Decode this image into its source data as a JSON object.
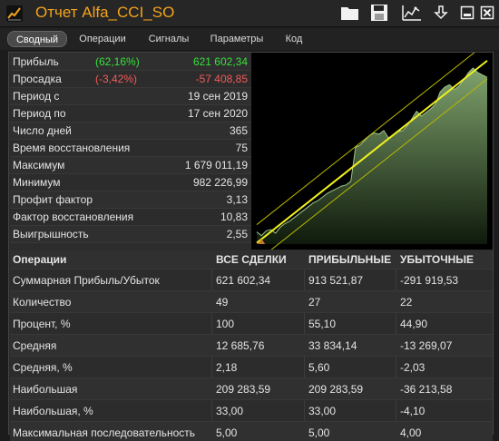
{
  "window": {
    "title": "Отчет Alfa_CCI_SO"
  },
  "icons": [
    "app-logo-icon",
    "folder-open-icon",
    "save-icon",
    "chart-export-icon",
    "download-icon",
    "minimize-icon",
    "close-icon"
  ],
  "tabs": [
    {
      "label": "Сводный",
      "active": true
    },
    {
      "label": "Операции",
      "active": false
    },
    {
      "label": "Сигналы",
      "active": false
    },
    {
      "label": "Параметры",
      "active": false
    },
    {
      "label": "Код",
      "active": false
    }
  ],
  "summary": [
    {
      "label": "Прибыль",
      "pct": "(62,16%)",
      "value": "621 602,34",
      "color": "#35e23a"
    },
    {
      "label": "Просадка",
      "pct": "(-3,42%)",
      "value": "-57 408,85",
      "color": "#f25a5a"
    },
    {
      "label": "Период с",
      "pct": "",
      "value": "19 сен 2019"
    },
    {
      "label": "Период по",
      "pct": "",
      "value": "17 сен 2020"
    },
    {
      "label": "Число дней",
      "pct": "",
      "value": "365"
    },
    {
      "label": "Время восстановления",
      "pct": "",
      "value": "75"
    },
    {
      "label": "Максимум",
      "pct": "",
      "value": "1 679 011,19"
    },
    {
      "label": "Минимум",
      "pct": "",
      "value": "982 226,99"
    },
    {
      "label": "Профит фактор",
      "pct": "",
      "value": "3,13"
    },
    {
      "label": "Фактор восстановления",
      "pct": "",
      "value": "10,83"
    },
    {
      "label": "Выигрышность",
      "pct": "",
      "value": "2,55"
    }
  ],
  "chart_data": {
    "type": "area",
    "title": "",
    "xlabel": "",
    "ylabel": "",
    "x": [
      1,
      2,
      3,
      4,
      5,
      6,
      7,
      8,
      9,
      10,
      11,
      12,
      13,
      14,
      15,
      16,
      17,
      18,
      19,
      20,
      21,
      22,
      23,
      24,
      25,
      26,
      27,
      28,
      29,
      30,
      31,
      32,
      33,
      34,
      35,
      36,
      37,
      38,
      39,
      40,
      41,
      42,
      43,
      44,
      45,
      46,
      47,
      48,
      49,
      50
    ],
    "series": [
      {
        "values": [
          1000000,
          985000,
          1005000,
          1010000,
          995000,
          1020000,
          1035000,
          1045000,
          1060000,
          1075000,
          1090000,
          1105000,
          1120000,
          1130000,
          1145000,
          1160000,
          1170000,
          1180000,
          1190000,
          1195000,
          1210000,
          1350000,
          1360000,
          1380000,
          1400000,
          1410000,
          1405000,
          1420000,
          1390000,
          1400000,
          1415000,
          1420000,
          1440000,
          1470000,
          1500000,
          1480000,
          1495000,
          1510000,
          1530000,
          1580000,
          1600000,
          1610000,
          1590000,
          1605000,
          1630000,
          1660000,
          1679011,
          1660000,
          1650000,
          1640000
        ],
        "color": "#5f7e52"
      }
    ],
    "trend_channel": {
      "line_color": "#f0f020",
      "band_color": "#b9b900"
    },
    "ylim": [
      950000,
      1720000
    ],
    "grid": false,
    "background": "#000000"
  },
  "table": {
    "headers": [
      "Операции",
      "ВСЕ СДЕЛКИ",
      "ПРИБЫЛЬНЫЕ",
      "УБЫТОЧНЫЕ"
    ],
    "rows": [
      [
        "Суммарная Прибыль/Убыток",
        "621 602,34",
        "913 521,87",
        "-291 919,53"
      ],
      [
        "Количество",
        "49",
        "27",
        "22"
      ],
      [
        "Процент, %",
        "100",
        "55,10",
        "44,90"
      ],
      [
        "Средняя",
        "12 685,76",
        "33 834,14",
        "-13 269,07"
      ],
      [
        "Средняя, %",
        "2,18",
        "5,60",
        "-2,03"
      ],
      [
        "Наибольшая",
        "209 283,59",
        "209 283,59",
        "-36 213,58"
      ],
      [
        "Наибольшая, %",
        "33,00",
        "33,00",
        "-4,10"
      ],
      [
        "Максимальная последовательность",
        "5,00",
        "5,00",
        "4,00"
      ]
    ]
  }
}
